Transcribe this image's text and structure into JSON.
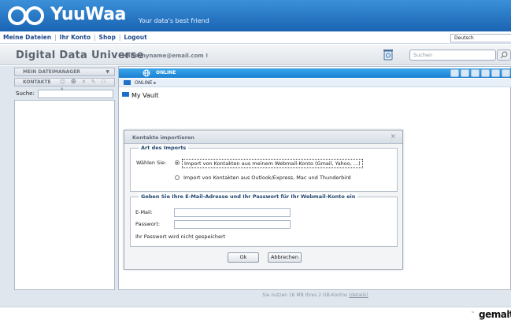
{
  "header": {
    "logo_text": "YuuWaa",
    "tagline": "Your data's best friend"
  },
  "nav": {
    "items": [
      "Meine Dateien",
      "Ihr Konto",
      "Shop",
      "Logout"
    ],
    "language": "Deutsch"
  },
  "title_row": {
    "app_title": "Digital Data Universe",
    "greeting": "Hallo myname@email.com !",
    "search_placeholder": "Suchen"
  },
  "left_panel": {
    "file_manager_label": "MEIN DATEIMANAGER",
    "contacts_label": "KONTAKTE",
    "search_label": "Suche:"
  },
  "main_panel": {
    "online_label": "ONLINE",
    "breadcrumb": "ONLINE",
    "vault_label": "My Vault",
    "usage_text": "Sie nutzen 16 MB Ihres 2 GB-Kontos",
    "details_link": "(details)"
  },
  "dialog": {
    "title": "Kontakte importieren",
    "group1_legend": "Art des Imports",
    "import_label": "Wählen Sie:",
    "option_1": "Import von Kontakten aus meinem Webmail-Konto (Gmail, Yahoo, ...)",
    "option_2": "Import von Kontakten aus Outlook/Express, Mac und Thunderbird",
    "group2_legend": "Geben Sie Ihre E-Mail-Adresse und Ihr Passwort für Ihr Webmail-Konto ein",
    "email_label": "E-Mail:",
    "password_label": "Passwort:",
    "password_note": "Ihr Passwort wird nicht gespeichert",
    "ok_label": "Ok",
    "cancel_label": "Abbrechen",
    "close_symbol": "×"
  },
  "footer": {
    "brand": "gemalto"
  },
  "colors": {
    "header_blue": "#1a63b3",
    "online_bar": "#1b7fd2",
    "legend_text": "#23466f"
  }
}
